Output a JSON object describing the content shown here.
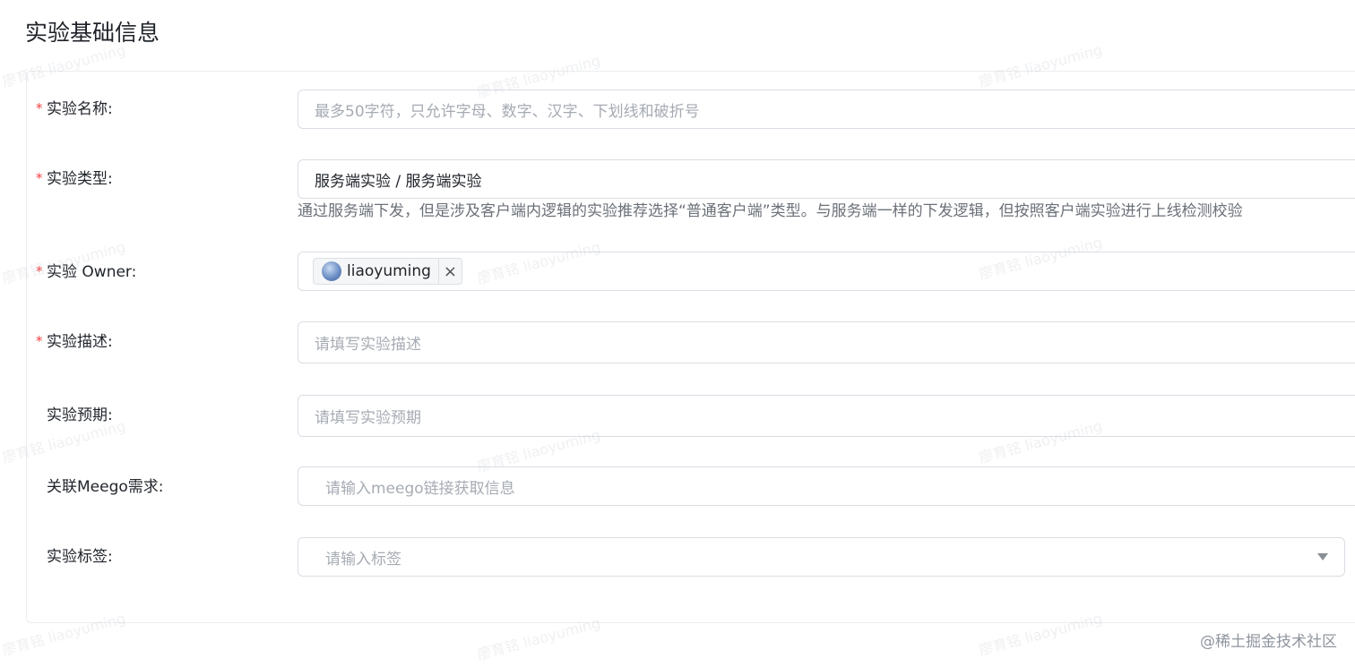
{
  "section": {
    "title": "实验基础信息"
  },
  "form": {
    "name": {
      "label": "实验名称:",
      "required": true,
      "placeholder": "最多50字符，只允许字母、数字、汉字、下划线和破折号"
    },
    "type": {
      "label": "实验类型:",
      "required": true,
      "value": "服务端实验 / 服务端实验",
      "help": "通过服务端下发，但是涉及客户端内逻辑的实验推荐选择“普通客户端”类型。与服务端一样的下发逻辑，但按照客户端实验进行上线检测校验"
    },
    "owner": {
      "label": "实验 Owner:",
      "required": true,
      "user": "liaoyuming",
      "avatar_icon": "user-avatar",
      "remove_icon": "close-icon"
    },
    "description": {
      "label": "实验描述:",
      "required": true,
      "placeholder": "请填写实验描述"
    },
    "expectation": {
      "label": "实验预期:",
      "required": false,
      "placeholder": "请填写实验预期"
    },
    "meego": {
      "label": "关联Meego需求:",
      "required": false,
      "placeholder": "请输入meego链接获取信息"
    },
    "tags": {
      "label": "实验标签:",
      "required": false,
      "placeholder": "请输入标签",
      "dropdown_icon": "caret-down-icon"
    }
  },
  "watermark": {
    "text": "廖育铭 liaoyuming"
  },
  "brand": {
    "text": "@稀土掘金技术社区"
  },
  "colors": {
    "required_star": "#f53f3f",
    "placeholder": "#a6abb3",
    "border": "#d9dde3"
  }
}
